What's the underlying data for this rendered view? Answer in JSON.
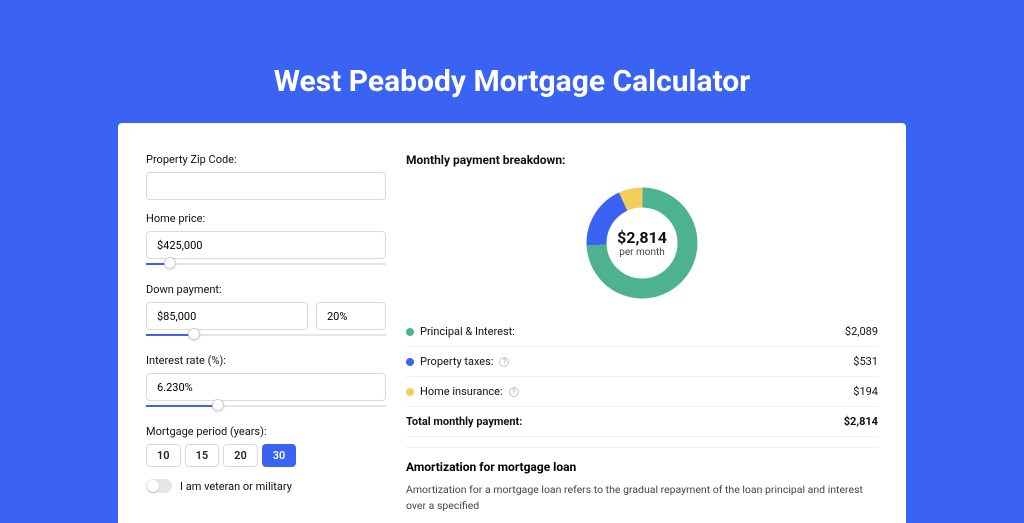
{
  "title": "West Peabody Mortgage Calculator",
  "form": {
    "zip_label": "Property Zip Code:",
    "zip_value": "",
    "home_price_label": "Home price:",
    "home_price_value": "$425,000",
    "down_payment_label": "Down payment:",
    "down_payment_amount": "$85,000",
    "down_payment_pct": "20%",
    "interest_label": "Interest rate (%):",
    "interest_value": "6.230%",
    "period_label": "Mortgage period (years):",
    "period_options": [
      "10",
      "15",
      "20",
      "30"
    ],
    "period_selected": "30",
    "veteran_label": "I am veteran or military",
    "slider_positions": {
      "home_price": 10,
      "down_payment": 20,
      "interest": 30
    }
  },
  "breakdown": {
    "title": "Monthly payment breakdown:",
    "center_amount": "$2,814",
    "center_per": "per month",
    "items": [
      {
        "label": "Principal & Interest:",
        "value": "$2,089",
        "color": "#4cb28f",
        "info": false
      },
      {
        "label": "Property taxes:",
        "value": "$531",
        "color": "#3a63f3",
        "info": true
      },
      {
        "label": "Home insurance:",
        "value": "$194",
        "color": "#f3cf57",
        "info": true
      }
    ],
    "total_label": "Total monthly payment:",
    "total_value": "$2,814"
  },
  "amortization": {
    "title": "Amortization for mortgage loan",
    "text": "Amortization for a mortgage loan refers to the gradual repayment of the loan principal and interest over a specified"
  },
  "chart_data": {
    "type": "pie",
    "title": "Monthly payment breakdown",
    "series": [
      {
        "name": "Principal & Interest",
        "value": 2089,
        "color": "#4cb28f"
      },
      {
        "name": "Property taxes",
        "value": 531,
        "color": "#3a63f3"
      },
      {
        "name": "Home insurance",
        "value": 194,
        "color": "#f3cf57"
      }
    ],
    "total": 2814,
    "center_label": "$2,814 per month"
  }
}
